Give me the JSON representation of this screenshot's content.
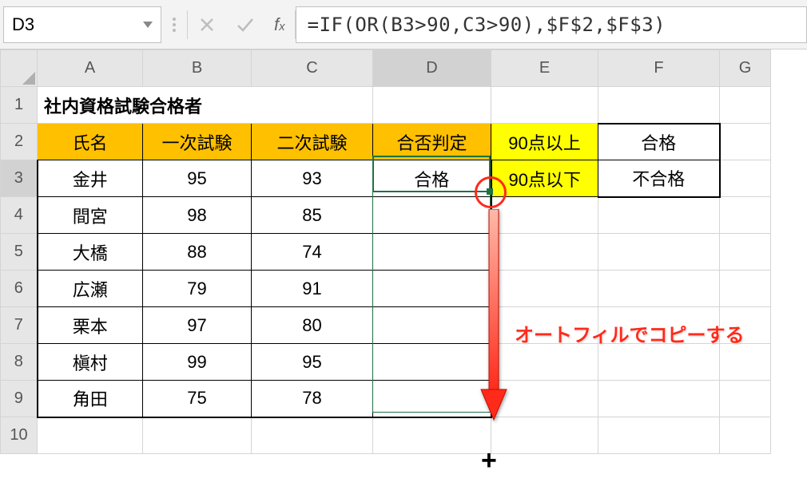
{
  "name_box": "D3",
  "formula": "=IF(OR(B3>90,C3>90),$F$2,$F$3)",
  "columns": [
    "A",
    "B",
    "C",
    "D",
    "E",
    "F",
    "G"
  ],
  "active_col": "D",
  "active_row": 3,
  "title": "社内資格試験合格者",
  "headers_orange": [
    "氏名",
    "一次試験",
    "二次試験",
    "合否判定"
  ],
  "headers_yellow": [
    "90点以上",
    "90点以下"
  ],
  "lookup_f": [
    "合格",
    "不合格"
  ],
  "rows": [
    {
      "name": "金井",
      "s1": "95",
      "s2": "93",
      "res": "合格"
    },
    {
      "name": "間宮",
      "s1": "98",
      "s2": "85",
      "res": ""
    },
    {
      "name": "大橋",
      "s1": "88",
      "s2": "74",
      "res": ""
    },
    {
      "name": "広瀬",
      "s1": "79",
      "s2": "91",
      "res": ""
    },
    {
      "name": "栗本",
      "s1": "97",
      "s2": "80",
      "res": ""
    },
    {
      "name": "槇村",
      "s1": "99",
      "s2": "95",
      "res": ""
    },
    {
      "name": "角田",
      "s1": "75",
      "s2": "78",
      "res": ""
    }
  ],
  "annotation": "オートフィルでコピーする"
}
